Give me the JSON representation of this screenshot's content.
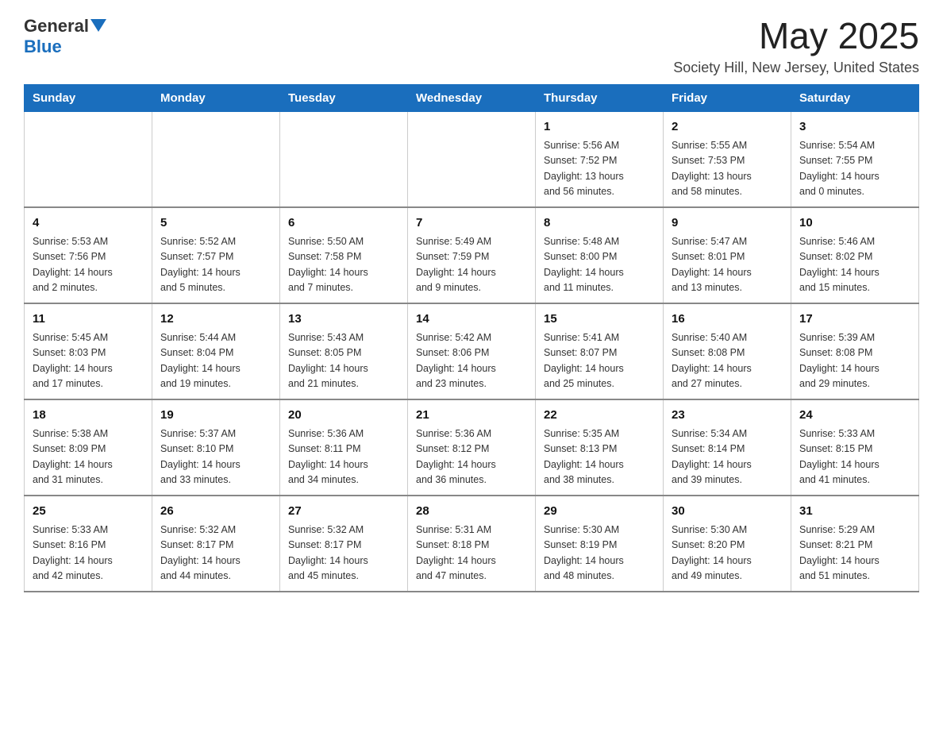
{
  "header": {
    "logo_general": "General",
    "logo_blue": "Blue",
    "month_year": "May 2025",
    "location": "Society Hill, New Jersey, United States"
  },
  "weekdays": [
    "Sunday",
    "Monday",
    "Tuesday",
    "Wednesday",
    "Thursday",
    "Friday",
    "Saturday"
  ],
  "weeks": [
    [
      {
        "day": "",
        "info": ""
      },
      {
        "day": "",
        "info": ""
      },
      {
        "day": "",
        "info": ""
      },
      {
        "day": "",
        "info": ""
      },
      {
        "day": "1",
        "info": "Sunrise: 5:56 AM\nSunset: 7:52 PM\nDaylight: 13 hours\nand 56 minutes."
      },
      {
        "day": "2",
        "info": "Sunrise: 5:55 AM\nSunset: 7:53 PM\nDaylight: 13 hours\nand 58 minutes."
      },
      {
        "day": "3",
        "info": "Sunrise: 5:54 AM\nSunset: 7:55 PM\nDaylight: 14 hours\nand 0 minutes."
      }
    ],
    [
      {
        "day": "4",
        "info": "Sunrise: 5:53 AM\nSunset: 7:56 PM\nDaylight: 14 hours\nand 2 minutes."
      },
      {
        "day": "5",
        "info": "Sunrise: 5:52 AM\nSunset: 7:57 PM\nDaylight: 14 hours\nand 5 minutes."
      },
      {
        "day": "6",
        "info": "Sunrise: 5:50 AM\nSunset: 7:58 PM\nDaylight: 14 hours\nand 7 minutes."
      },
      {
        "day": "7",
        "info": "Sunrise: 5:49 AM\nSunset: 7:59 PM\nDaylight: 14 hours\nand 9 minutes."
      },
      {
        "day": "8",
        "info": "Sunrise: 5:48 AM\nSunset: 8:00 PM\nDaylight: 14 hours\nand 11 minutes."
      },
      {
        "day": "9",
        "info": "Sunrise: 5:47 AM\nSunset: 8:01 PM\nDaylight: 14 hours\nand 13 minutes."
      },
      {
        "day": "10",
        "info": "Sunrise: 5:46 AM\nSunset: 8:02 PM\nDaylight: 14 hours\nand 15 minutes."
      }
    ],
    [
      {
        "day": "11",
        "info": "Sunrise: 5:45 AM\nSunset: 8:03 PM\nDaylight: 14 hours\nand 17 minutes."
      },
      {
        "day": "12",
        "info": "Sunrise: 5:44 AM\nSunset: 8:04 PM\nDaylight: 14 hours\nand 19 minutes."
      },
      {
        "day": "13",
        "info": "Sunrise: 5:43 AM\nSunset: 8:05 PM\nDaylight: 14 hours\nand 21 minutes."
      },
      {
        "day": "14",
        "info": "Sunrise: 5:42 AM\nSunset: 8:06 PM\nDaylight: 14 hours\nand 23 minutes."
      },
      {
        "day": "15",
        "info": "Sunrise: 5:41 AM\nSunset: 8:07 PM\nDaylight: 14 hours\nand 25 minutes."
      },
      {
        "day": "16",
        "info": "Sunrise: 5:40 AM\nSunset: 8:08 PM\nDaylight: 14 hours\nand 27 minutes."
      },
      {
        "day": "17",
        "info": "Sunrise: 5:39 AM\nSunset: 8:08 PM\nDaylight: 14 hours\nand 29 minutes."
      }
    ],
    [
      {
        "day": "18",
        "info": "Sunrise: 5:38 AM\nSunset: 8:09 PM\nDaylight: 14 hours\nand 31 minutes."
      },
      {
        "day": "19",
        "info": "Sunrise: 5:37 AM\nSunset: 8:10 PM\nDaylight: 14 hours\nand 33 minutes."
      },
      {
        "day": "20",
        "info": "Sunrise: 5:36 AM\nSunset: 8:11 PM\nDaylight: 14 hours\nand 34 minutes."
      },
      {
        "day": "21",
        "info": "Sunrise: 5:36 AM\nSunset: 8:12 PM\nDaylight: 14 hours\nand 36 minutes."
      },
      {
        "day": "22",
        "info": "Sunrise: 5:35 AM\nSunset: 8:13 PM\nDaylight: 14 hours\nand 38 minutes."
      },
      {
        "day": "23",
        "info": "Sunrise: 5:34 AM\nSunset: 8:14 PM\nDaylight: 14 hours\nand 39 minutes."
      },
      {
        "day": "24",
        "info": "Sunrise: 5:33 AM\nSunset: 8:15 PM\nDaylight: 14 hours\nand 41 minutes."
      }
    ],
    [
      {
        "day": "25",
        "info": "Sunrise: 5:33 AM\nSunset: 8:16 PM\nDaylight: 14 hours\nand 42 minutes."
      },
      {
        "day": "26",
        "info": "Sunrise: 5:32 AM\nSunset: 8:17 PM\nDaylight: 14 hours\nand 44 minutes."
      },
      {
        "day": "27",
        "info": "Sunrise: 5:32 AM\nSunset: 8:17 PM\nDaylight: 14 hours\nand 45 minutes."
      },
      {
        "day": "28",
        "info": "Sunrise: 5:31 AM\nSunset: 8:18 PM\nDaylight: 14 hours\nand 47 minutes."
      },
      {
        "day": "29",
        "info": "Sunrise: 5:30 AM\nSunset: 8:19 PM\nDaylight: 14 hours\nand 48 minutes."
      },
      {
        "day": "30",
        "info": "Sunrise: 5:30 AM\nSunset: 8:20 PM\nDaylight: 14 hours\nand 49 minutes."
      },
      {
        "day": "31",
        "info": "Sunrise: 5:29 AM\nSunset: 8:21 PM\nDaylight: 14 hours\nand 51 minutes."
      }
    ]
  ]
}
